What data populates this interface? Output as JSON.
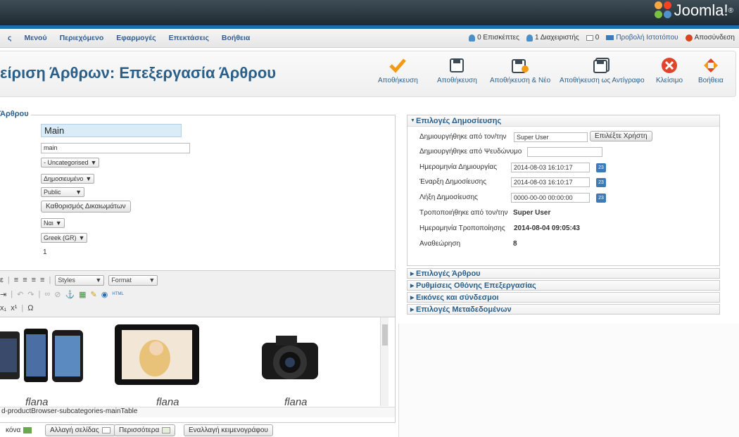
{
  "brand": {
    "name": "Joomla!",
    "superscript": "®"
  },
  "menu": [
    "ς",
    "Μενού",
    "Περιεχόμενο",
    "Εφαρμογές",
    "Επεκτάσεις",
    "Βοήθεια"
  ],
  "status": {
    "visitors": "0 Επισκέπτες",
    "admins": "1 Διαχειριστής",
    "messages": "0",
    "view_site": "Προβολή Ιστοτόπου",
    "logout": "Αποσύνδεση"
  },
  "page_title": "είριση Άρθρων: Επεξεργασία Άρθρου",
  "toolbar": {
    "save": "Αποθήκευση",
    "save_close": "Αποθήκευση",
    "save_new": "Αποθήκευση & Νέο",
    "save_copy": "Αποθήκευση ως Αντίγραφο",
    "close": "Κλείσιμο",
    "help": "Βοήθεια"
  },
  "form": {
    "legend": "Άρθρου",
    "title_value": "Main",
    "alias_value": "main",
    "category": "- Uncategorised",
    "status": "Δημοσιευμένο",
    "access": "Public",
    "permissions_button": "Καθορισμός Δικαιωμάτων",
    "featured": "Ναι",
    "language": "Greek (GR)",
    "id": "1"
  },
  "editor": {
    "styles": "Styles",
    "format": "Format",
    "path": "d-productBrowser-subcategories-mainTable",
    "captions": [
      "flana",
      "flana",
      "flana"
    ]
  },
  "bottom_buttons": [
    "κόνα",
    "Αλλαγή σελίδας",
    "Περισσότερα",
    "Εναλλαγή κειμενογράφου"
  ],
  "publishing": {
    "header": "Επιλογές Δημοσίευσης",
    "created_by_label": "Δημιουργήθηκε από τον/την",
    "created_by_value": "Super User",
    "select_user_button": "Επιλέξτε Χρήστη",
    "created_alias_label": "Δημιουργήθηκε από Ψευδώνυμο",
    "created_alias_value": "",
    "created_date_label": "Ημερομηνία Δημιουργίας",
    "created_date_value": "2014-08-03 16:10:17",
    "publish_up_label": "Έναρξη Δημοσίευσης",
    "publish_up_value": "2014-08-03 16:10:17",
    "publish_down_label": "Λήξη Δημοσίευσης",
    "publish_down_value": "0000-00-00 00:00:00",
    "modified_by_label": "Τροποποιήθηκε από τον/την",
    "modified_by_value": "Super User",
    "modified_date_label": "Ημερομηνία Τροποποίησης",
    "modified_date_value": "2014-08-04 09:05:43",
    "revision_label": "Αναθεώρηση",
    "revision_value": "8",
    "calendar_label": "23"
  },
  "accordions": [
    "Επιλογές Άρθρου",
    "Ρυθμίσεις Οθόνης Επεξεργασίας",
    "Εικόνες και σύνδεσμοι",
    "Επιλογές Μεταδεδομένων"
  ],
  "colors": {
    "accent": "#2a5f8a",
    "topbar": "#1f2a31",
    "menu_border": "#1a6fae"
  }
}
